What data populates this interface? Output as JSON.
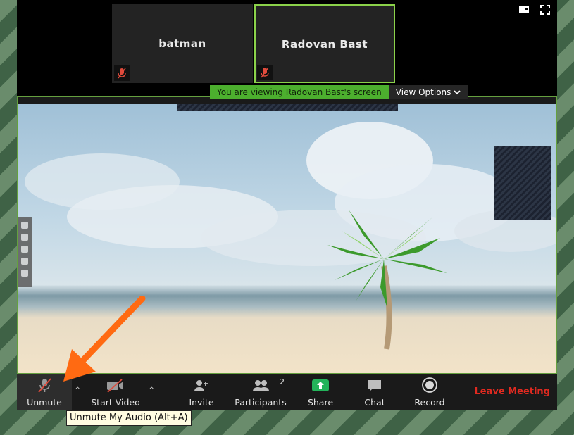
{
  "participants": [
    {
      "name": "batman",
      "mic": "mic-muted-icon",
      "active": false
    },
    {
      "name": "Radovan Bast",
      "mic": "mic-muted-icon",
      "active": true
    }
  ],
  "banner": {
    "viewing_text": "You are viewing Radovan Bast's screen",
    "view_options_label": "View Options"
  },
  "toolbar": {
    "unmute": "Unmute",
    "start_video": "Start Video",
    "invite": "Invite",
    "participants": "Participants",
    "participant_count": "2",
    "share": "Share",
    "chat": "Chat",
    "record": "Record",
    "leave": "Leave Meeting"
  },
  "tooltip": "Unmute My Audio (Alt+A)",
  "colors": {
    "accent_green": "#4caf2e",
    "leave_red": "#e02a20",
    "muted_red": "#e04b3c",
    "share_green": "#23b35a"
  }
}
